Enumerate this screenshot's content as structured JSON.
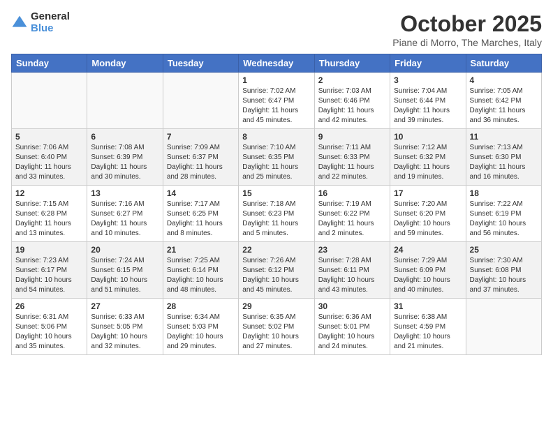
{
  "header": {
    "logo_general": "General",
    "logo_blue": "Blue",
    "month_title": "October 2025",
    "location": "Piane di Morro, The Marches, Italy"
  },
  "days_of_week": [
    "Sunday",
    "Monday",
    "Tuesday",
    "Wednesday",
    "Thursday",
    "Friday",
    "Saturday"
  ],
  "weeks": [
    [
      {
        "day": "",
        "info": ""
      },
      {
        "day": "",
        "info": ""
      },
      {
        "day": "",
        "info": ""
      },
      {
        "day": "1",
        "info": "Sunrise: 7:02 AM\nSunset: 6:47 PM\nDaylight: 11 hours\nand 45 minutes."
      },
      {
        "day": "2",
        "info": "Sunrise: 7:03 AM\nSunset: 6:46 PM\nDaylight: 11 hours\nand 42 minutes."
      },
      {
        "day": "3",
        "info": "Sunrise: 7:04 AM\nSunset: 6:44 PM\nDaylight: 11 hours\nand 39 minutes."
      },
      {
        "day": "4",
        "info": "Sunrise: 7:05 AM\nSunset: 6:42 PM\nDaylight: 11 hours\nand 36 minutes."
      }
    ],
    [
      {
        "day": "5",
        "info": "Sunrise: 7:06 AM\nSunset: 6:40 PM\nDaylight: 11 hours\nand 33 minutes."
      },
      {
        "day": "6",
        "info": "Sunrise: 7:08 AM\nSunset: 6:39 PM\nDaylight: 11 hours\nand 30 minutes."
      },
      {
        "day": "7",
        "info": "Sunrise: 7:09 AM\nSunset: 6:37 PM\nDaylight: 11 hours\nand 28 minutes."
      },
      {
        "day": "8",
        "info": "Sunrise: 7:10 AM\nSunset: 6:35 PM\nDaylight: 11 hours\nand 25 minutes."
      },
      {
        "day": "9",
        "info": "Sunrise: 7:11 AM\nSunset: 6:33 PM\nDaylight: 11 hours\nand 22 minutes."
      },
      {
        "day": "10",
        "info": "Sunrise: 7:12 AM\nSunset: 6:32 PM\nDaylight: 11 hours\nand 19 minutes."
      },
      {
        "day": "11",
        "info": "Sunrise: 7:13 AM\nSunset: 6:30 PM\nDaylight: 11 hours\nand 16 minutes."
      }
    ],
    [
      {
        "day": "12",
        "info": "Sunrise: 7:15 AM\nSunset: 6:28 PM\nDaylight: 11 hours\nand 13 minutes."
      },
      {
        "day": "13",
        "info": "Sunrise: 7:16 AM\nSunset: 6:27 PM\nDaylight: 11 hours\nand 10 minutes."
      },
      {
        "day": "14",
        "info": "Sunrise: 7:17 AM\nSunset: 6:25 PM\nDaylight: 11 hours\nand 8 minutes."
      },
      {
        "day": "15",
        "info": "Sunrise: 7:18 AM\nSunset: 6:23 PM\nDaylight: 11 hours\nand 5 minutes."
      },
      {
        "day": "16",
        "info": "Sunrise: 7:19 AM\nSunset: 6:22 PM\nDaylight: 11 hours\nand 2 minutes."
      },
      {
        "day": "17",
        "info": "Sunrise: 7:20 AM\nSunset: 6:20 PM\nDaylight: 10 hours\nand 59 minutes."
      },
      {
        "day": "18",
        "info": "Sunrise: 7:22 AM\nSunset: 6:19 PM\nDaylight: 10 hours\nand 56 minutes."
      }
    ],
    [
      {
        "day": "19",
        "info": "Sunrise: 7:23 AM\nSunset: 6:17 PM\nDaylight: 10 hours\nand 54 minutes."
      },
      {
        "day": "20",
        "info": "Sunrise: 7:24 AM\nSunset: 6:15 PM\nDaylight: 10 hours\nand 51 minutes."
      },
      {
        "day": "21",
        "info": "Sunrise: 7:25 AM\nSunset: 6:14 PM\nDaylight: 10 hours\nand 48 minutes."
      },
      {
        "day": "22",
        "info": "Sunrise: 7:26 AM\nSunset: 6:12 PM\nDaylight: 10 hours\nand 45 minutes."
      },
      {
        "day": "23",
        "info": "Sunrise: 7:28 AM\nSunset: 6:11 PM\nDaylight: 10 hours\nand 43 minutes."
      },
      {
        "day": "24",
        "info": "Sunrise: 7:29 AM\nSunset: 6:09 PM\nDaylight: 10 hours\nand 40 minutes."
      },
      {
        "day": "25",
        "info": "Sunrise: 7:30 AM\nSunset: 6:08 PM\nDaylight: 10 hours\nand 37 minutes."
      }
    ],
    [
      {
        "day": "26",
        "info": "Sunrise: 6:31 AM\nSunset: 5:06 PM\nDaylight: 10 hours\nand 35 minutes."
      },
      {
        "day": "27",
        "info": "Sunrise: 6:33 AM\nSunset: 5:05 PM\nDaylight: 10 hours\nand 32 minutes."
      },
      {
        "day": "28",
        "info": "Sunrise: 6:34 AM\nSunset: 5:03 PM\nDaylight: 10 hours\nand 29 minutes."
      },
      {
        "day": "29",
        "info": "Sunrise: 6:35 AM\nSunset: 5:02 PM\nDaylight: 10 hours\nand 27 minutes."
      },
      {
        "day": "30",
        "info": "Sunrise: 6:36 AM\nSunset: 5:01 PM\nDaylight: 10 hours\nand 24 minutes."
      },
      {
        "day": "31",
        "info": "Sunrise: 6:38 AM\nSunset: 4:59 PM\nDaylight: 10 hours\nand 21 minutes."
      },
      {
        "day": "",
        "info": ""
      }
    ]
  ]
}
